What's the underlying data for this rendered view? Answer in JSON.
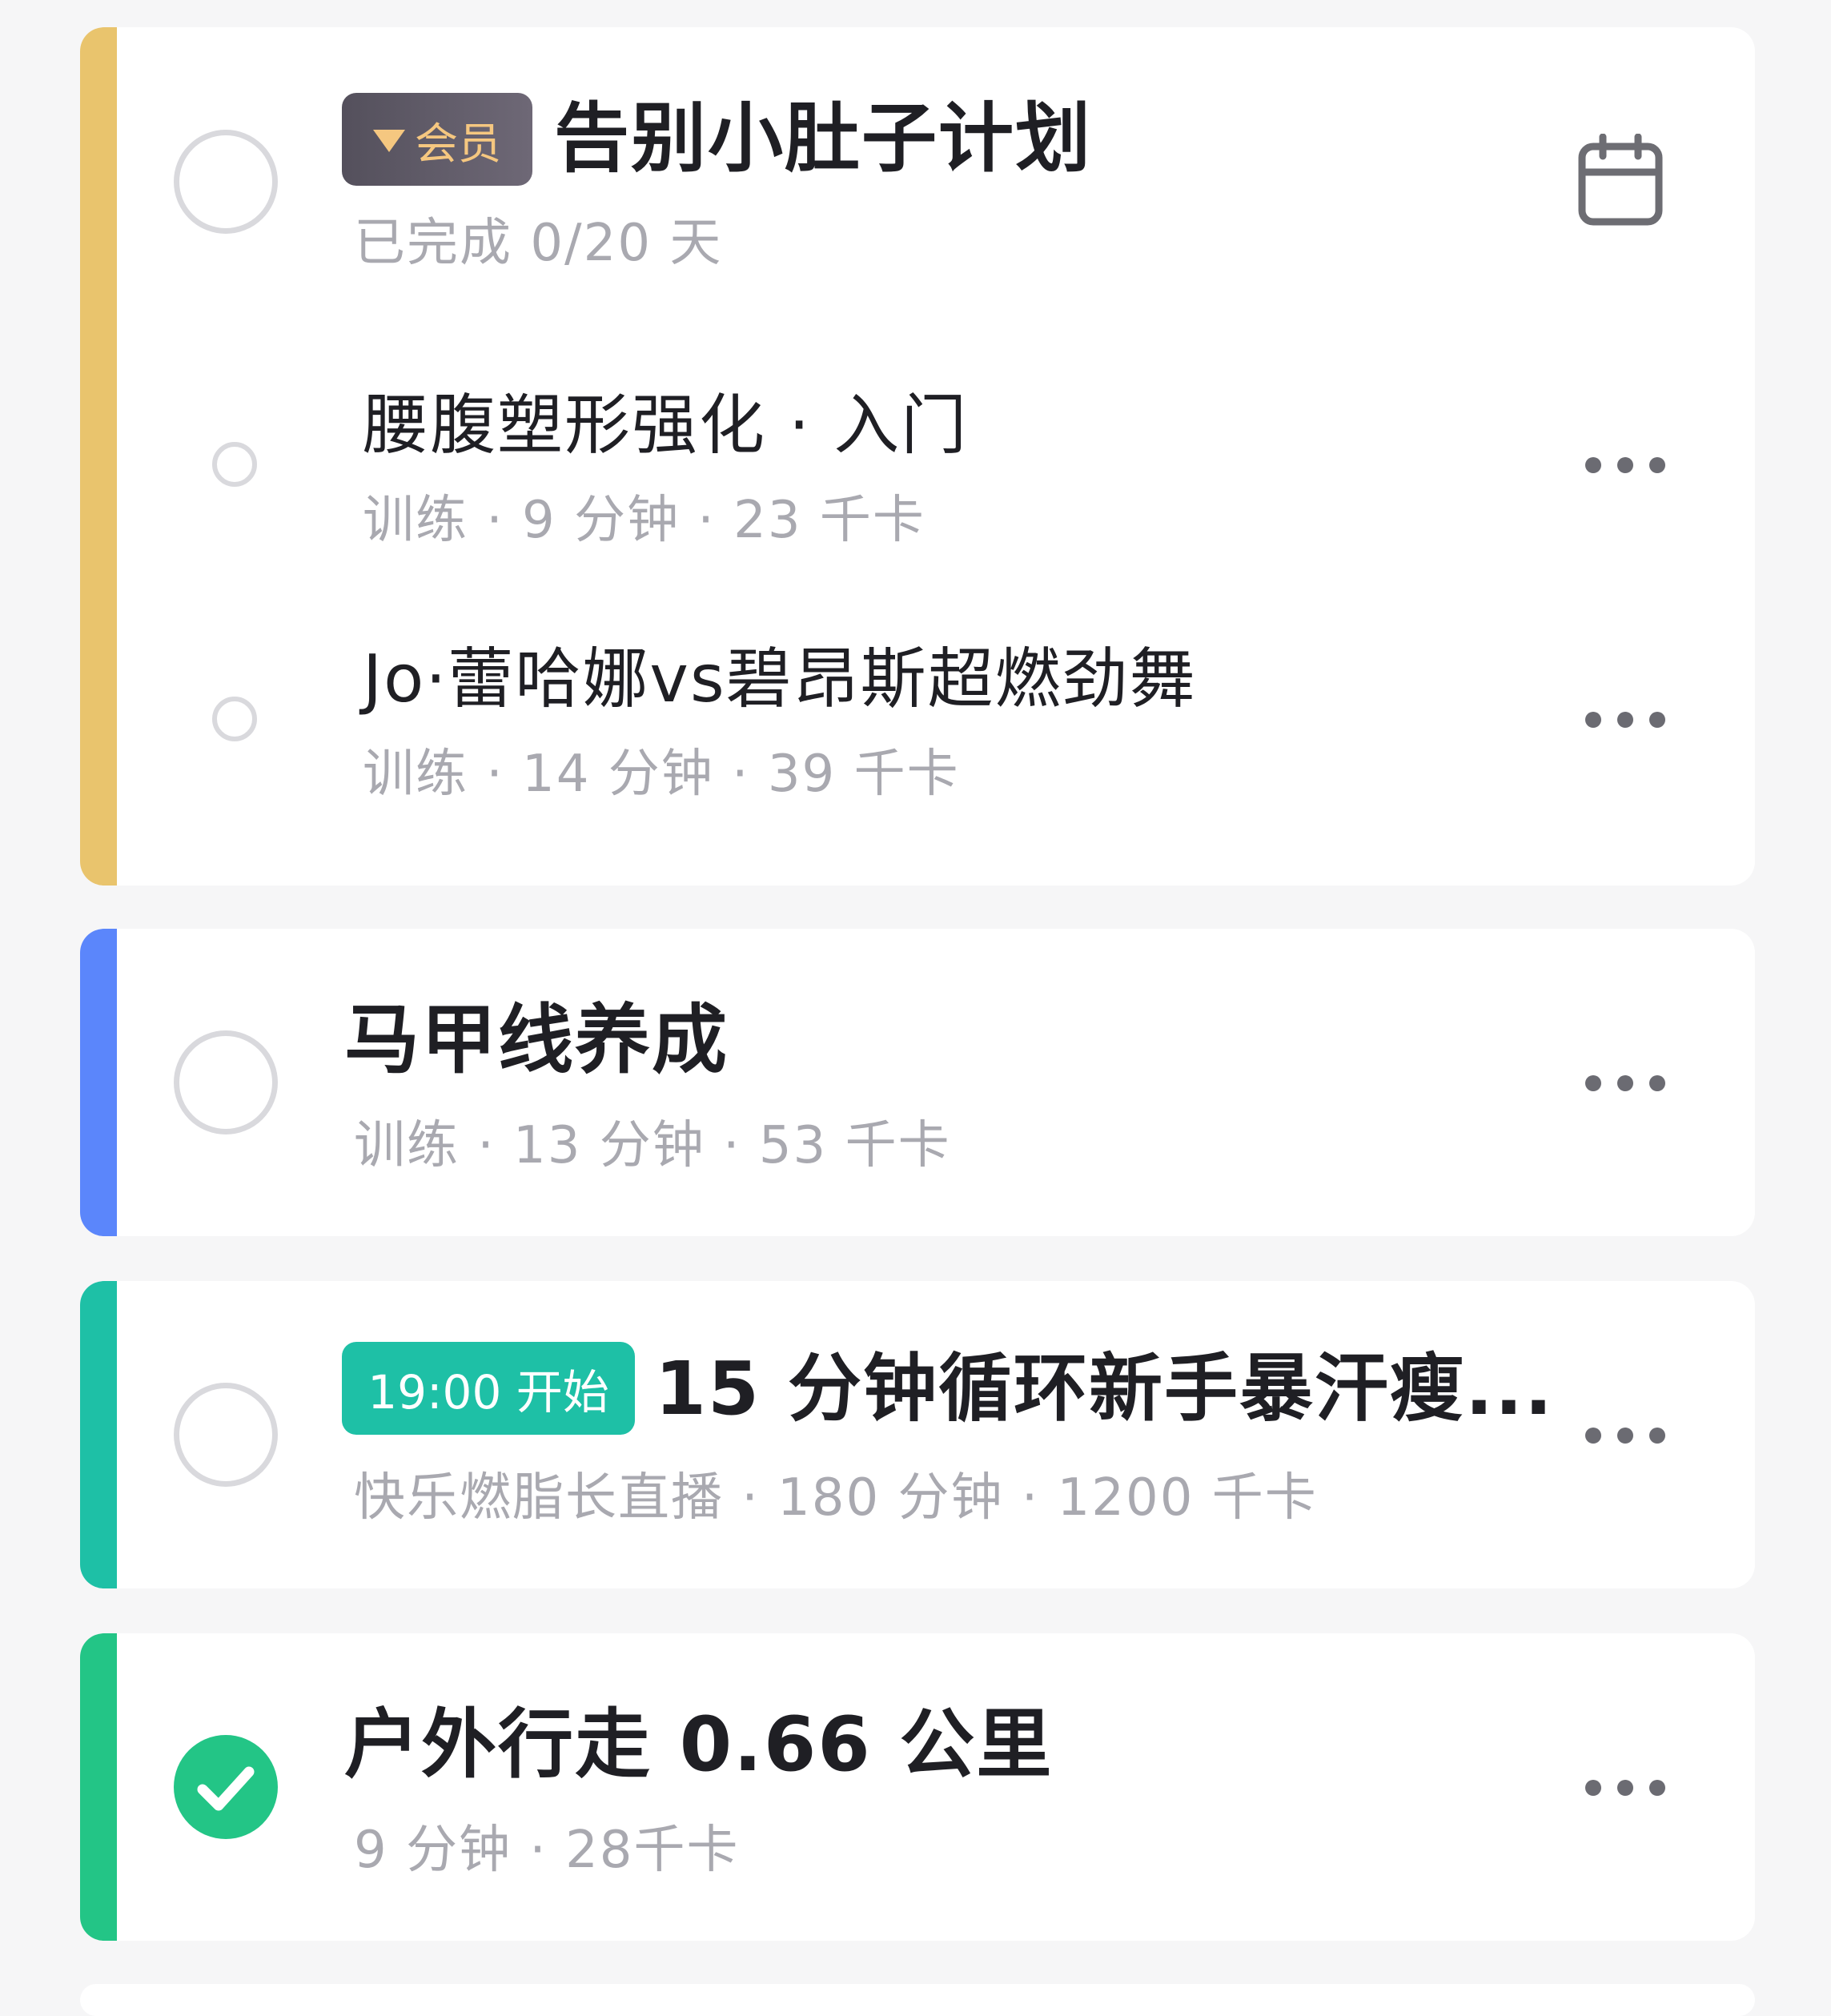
{
  "colors": {
    "plan_strip": "#e9c46d",
    "blue_strip": "#5b86fb",
    "teal_strip": "#1ec0a6",
    "green_strip": "#23c586",
    "member_badge_text": "#f5c780",
    "time_badge_bg": "#1ec0a6",
    "done_check_bg": "#23c586"
  },
  "plan": {
    "badge_icon": "member-triangle-icon",
    "badge_label": "会员",
    "title": "告别小肚子计划",
    "progress": "已完成 0/20 天",
    "calendar_icon": "calendar-icon",
    "items": [
      {
        "title": "腰腹塑形强化 · 入门",
        "meta": "训练 · 9 分钟 · 23 千卡"
      },
      {
        "title": "Jo·蕾哈娜vs碧昂斯超燃劲舞",
        "meta": "训练 · 14 分钟 · 39 千卡"
      }
    ]
  },
  "tasks": [
    {
      "title": "马甲线养成",
      "meta": "训练 · 13 分钟 · 53 千卡",
      "done": false
    },
    {
      "badge_label": "19:00 开始",
      "title": "15 分钟循环新手暴汗瘦...",
      "meta": "快乐燃脂长直播 · 180 分钟 · 1200 千卡",
      "done": false
    },
    {
      "title": "户外行走 0.66 公里",
      "meta": "9 分钟 · 28千卡",
      "done": true
    }
  ]
}
